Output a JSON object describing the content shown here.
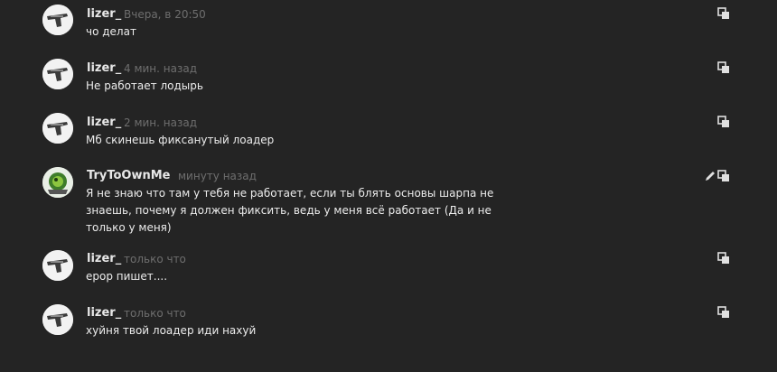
{
  "messages": [
    {
      "author": "lizer_",
      "time": "Вчера, в 20:50",
      "text": "чо делат",
      "avatar_icon": "gun-avatar-icon",
      "actions": [
        "copy-icon"
      ]
    },
    {
      "author": "lizer_",
      "time": "4 мин. назад",
      "text": "Не работает лодырь",
      "avatar_icon": "gun-avatar-icon",
      "actions": [
        "copy-icon"
      ]
    },
    {
      "author": "lizer_",
      "time": "2 мин. назад",
      "text": "Мб скинешь фиксанутый лоадер",
      "avatar_icon": "gun-avatar-icon",
      "actions": [
        "copy-icon"
      ]
    },
    {
      "author": "TryToOwnMe",
      "time": "минуту назад",
      "text": "Я не знаю что там у тебя не работает, если ты блять основы шарпа не знаешь, почему я должен фиксить, ведь у меня всё работает (Да и не только у меня)",
      "avatar_icon": "green-creature-avatar-icon",
      "actions": [
        "edit-icon",
        "copy-icon"
      ]
    },
    {
      "author": "lizer_",
      "time": "только что",
      "text": "ерор пишет....",
      "avatar_icon": "gun-avatar-icon",
      "actions": [
        "copy-icon"
      ]
    },
    {
      "author": "lizer_",
      "time": "только что",
      "text": "хуйня твой лоадер иди нахуй",
      "avatar_icon": "gun-avatar-icon",
      "actions": [
        "copy-icon"
      ]
    }
  ],
  "colors": {
    "background": "#242424",
    "author": "#e8e8e8",
    "timestamp": "#6e6e6e",
    "text": "#ececec"
  }
}
